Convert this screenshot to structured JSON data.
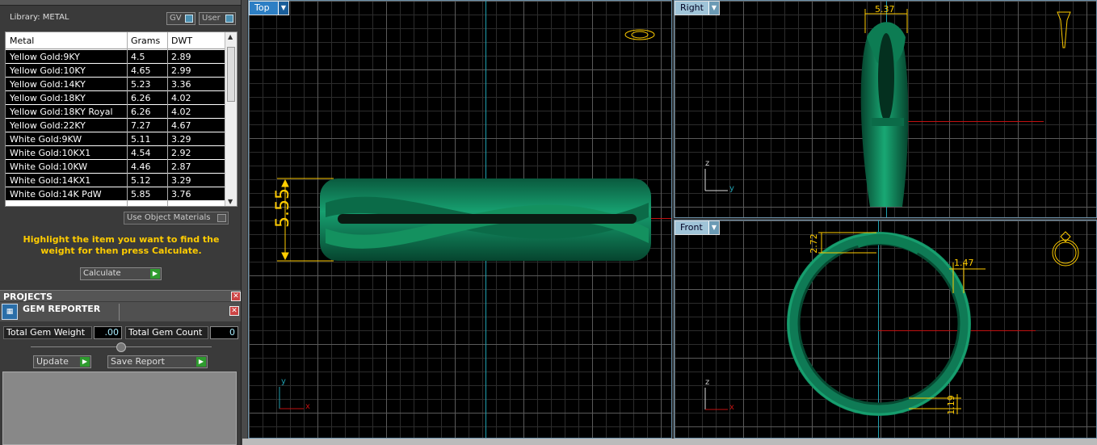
{
  "library": {
    "label": "Library: METAL",
    "gv_label": "GV",
    "user_label": "User"
  },
  "metal_table": {
    "columns": [
      "Metal",
      "Grams",
      "DWT"
    ],
    "rows": [
      [
        "Yellow Gold:9KY",
        "4.5",
        "2.89"
      ],
      [
        "Yellow Gold:10KY",
        "4.65",
        "2.99"
      ],
      [
        "Yellow Gold:14KY",
        "5.23",
        "3.36"
      ],
      [
        "Yellow Gold:18KY",
        "6.26",
        "4.02"
      ],
      [
        "Yellow Gold:18KY Royal",
        "6.26",
        "4.02"
      ],
      [
        "Yellow Gold:22KY",
        "7.27",
        "4.67"
      ],
      [
        "White Gold:9KW",
        "5.11",
        "3.29"
      ],
      [
        "White Gold:10KX1",
        "4.54",
        "2.92"
      ],
      [
        "White Gold:10KW",
        "4.46",
        "2.87"
      ],
      [
        "White Gold:14KX1",
        "5.12",
        "3.29"
      ],
      [
        "White Gold:14K PdW",
        "5.85",
        "3.76"
      ]
    ]
  },
  "use_object_materials": "Use Object Materials",
  "hint": "Highlight the item you want to find the weight for then press Calculate.",
  "calculate_label": "Calculate",
  "projects_label": "PROJECTS",
  "gem_reporter": {
    "title": "GEM REPORTER",
    "total_weight_label": "Total Gem Weight",
    "total_weight_value": ".00",
    "total_count_label": "Total Gem Count",
    "total_count_value": "0",
    "update_label": "Update",
    "save_report_label": "Save Report"
  },
  "viewports": {
    "top": {
      "name": "Top",
      "dimension": "5.55",
      "axis_y": "y",
      "axis_x": "x"
    },
    "right": {
      "name": "Right",
      "dimension": "5.37",
      "axis_z": "z",
      "axis_y": "y"
    },
    "front": {
      "name": "Front",
      "dimension_a": "2.72",
      "dimension_b": "1.47",
      "dimension_c": "1.19",
      "axis_z": "z",
      "axis_x": "x"
    }
  },
  "colors": {
    "model": "#0f7a55",
    "axis_vertical": "#1fa0b0",
    "axis_horizontal": "#c01010",
    "dimension": "#ffcc00",
    "active_tab": "#2d7fc4"
  }
}
